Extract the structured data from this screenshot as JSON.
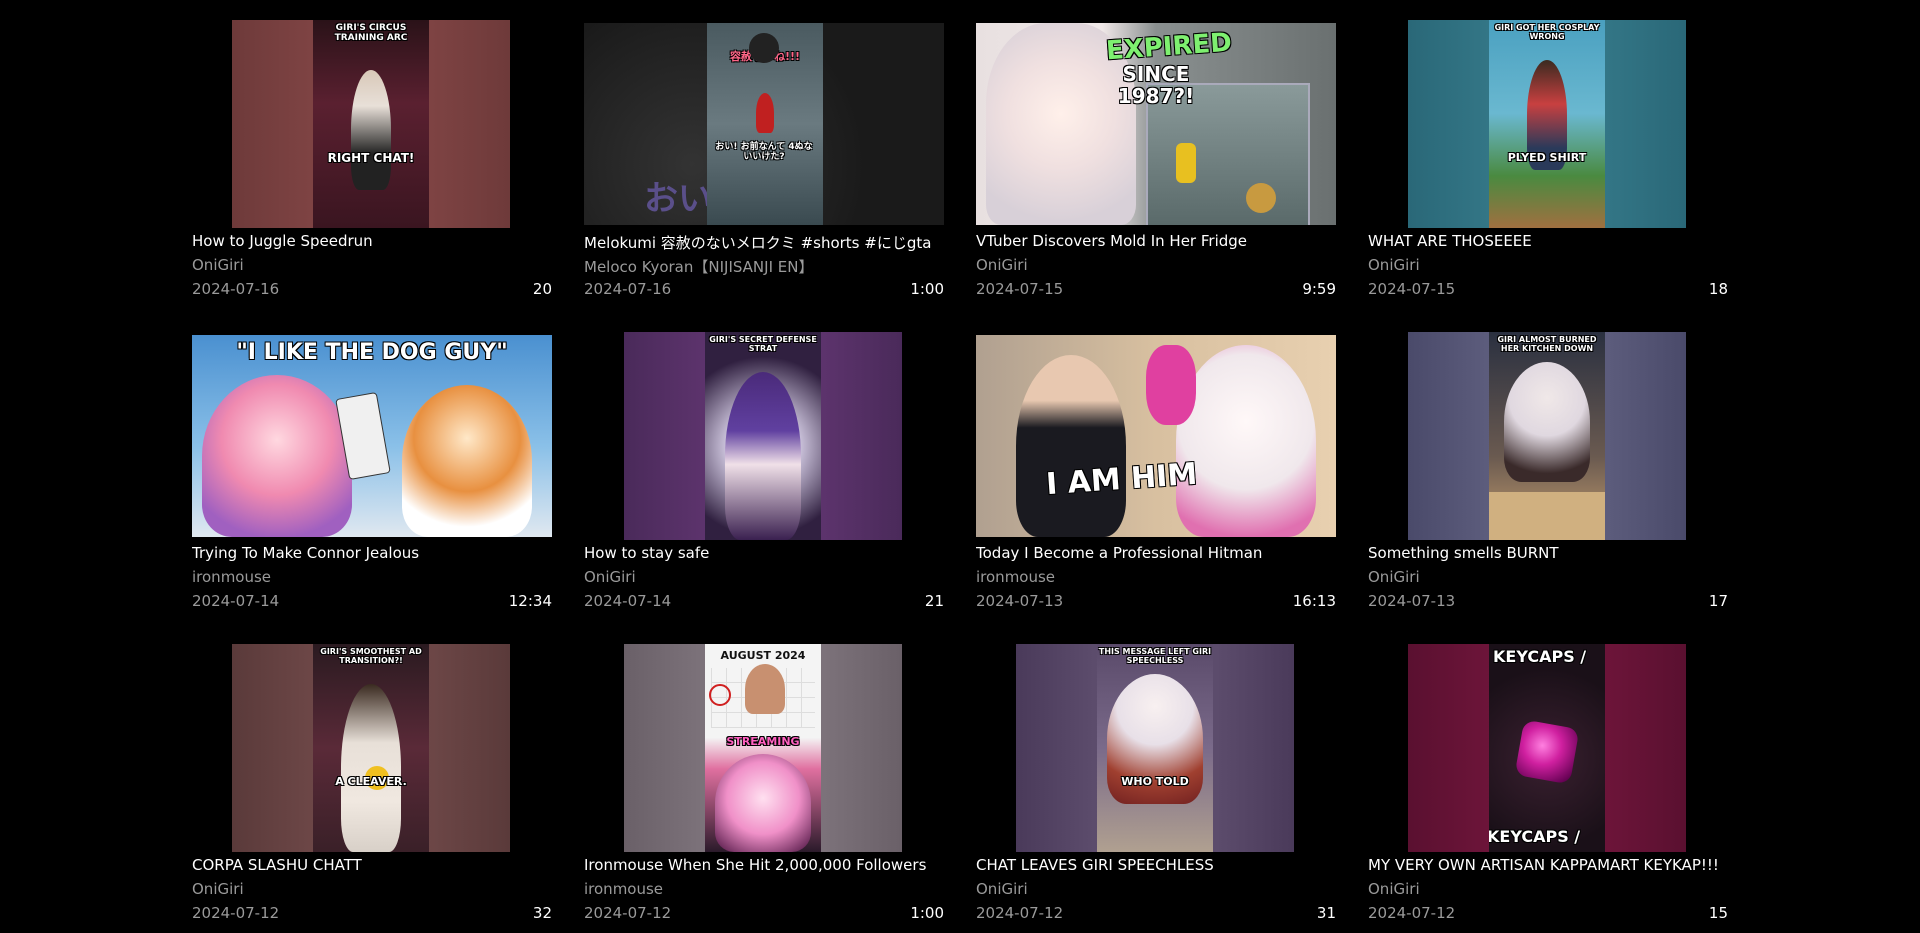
{
  "videos": [
    {
      "title": "How to Juggle Speedrun",
      "channel": "OniGiri",
      "date": "2024-07-16",
      "duration": "20",
      "thumb_text_top": "GIRI'S CIRCUS TRAINING ARC",
      "thumb_text_bottom": "RIGHT CHAT!"
    },
    {
      "title": "Melokumi 容赦のないメロクミ #shorts #にじgta",
      "channel": "Meloco Kyoran【NIJISANJI EN】",
      "date": "2024-07-16",
      "duration": "1:00",
      "thumb_text_top": "容赦ないね!!!",
      "thumb_text_bottom": "おい! お前なんて 4ぬないいけた?",
      "thumb_text_bg": "おい"
    },
    {
      "title": "VTuber Discovers Mold In Her Fridge",
      "channel": "OniGiri",
      "date": "2024-07-15",
      "duration": "9:59",
      "thumb_text_top": "EXPIRED",
      "thumb_text_bottom": "SINCE 1987?!"
    },
    {
      "title": "WHAT ARE THOSEEEE",
      "channel": "OniGiri",
      "date": "2024-07-15",
      "duration": "18",
      "thumb_text_top": "GIRI GOT HER COSPLAY WRONG",
      "thumb_text_bottom": "PLYED SHIRT"
    },
    {
      "title": "Trying To Make Connor Jealous",
      "channel": "ironmouse",
      "date": "2024-07-14",
      "duration": "12:34",
      "thumb_text_top": "\"I LIKE THE DOG GUY\""
    },
    {
      "title": "How to stay safe",
      "channel": "OniGiri",
      "date": "2024-07-14",
      "duration": "21",
      "thumb_text_top": "GIRI'S SECRET DEFENSE STRAT"
    },
    {
      "title": "Today I Become a Professional Hitman",
      "channel": "ironmouse",
      "date": "2024-07-13",
      "duration": "16:13",
      "thumb_text_bottom": "I AM HIM"
    },
    {
      "title": "Something smells BURNT",
      "channel": "OniGiri",
      "date": "2024-07-13",
      "duration": "17",
      "thumb_text_top": "GIRI ALMOST BURNED HER KITCHEN DOWN"
    },
    {
      "title": "CORPA SLASHU CHATT",
      "channel": "OniGiri",
      "date": "2024-07-12",
      "duration": "32",
      "thumb_text_top": "GIRI'S SMOOTHEST AD TRANSITION?!",
      "thumb_text_bottom": "A CLEAVER."
    },
    {
      "title": "Ironmouse When She Hit 2,000,000 Followers",
      "channel": "ironmouse",
      "date": "2024-07-12",
      "duration": "1:00",
      "thumb_text_top": "AUGUST 2024",
      "thumb_text_bottom": "STREAMING"
    },
    {
      "title": "CHAT LEAVES GIRI SPEECHLESS",
      "channel": "OniGiri",
      "date": "2024-07-12",
      "duration": "31",
      "thumb_text_top": "THIS MESSAGE LEFT GIRI SPEECHLESS",
      "thumb_text_bottom": "WHO TOLD"
    },
    {
      "title": "MY VERY OWN ARTISAN KAPPAMART KEYKAP!!!",
      "channel": "OniGiri",
      "date": "2024-07-12",
      "duration": "15",
      "thumb_text_top": "KEYCAPS /",
      "thumb_text_bottom": "KEYCAPS / "
    }
  ],
  "colors": {
    "background": "#000000",
    "title": "#ffffff",
    "secondary": "#9a9a9a"
  }
}
